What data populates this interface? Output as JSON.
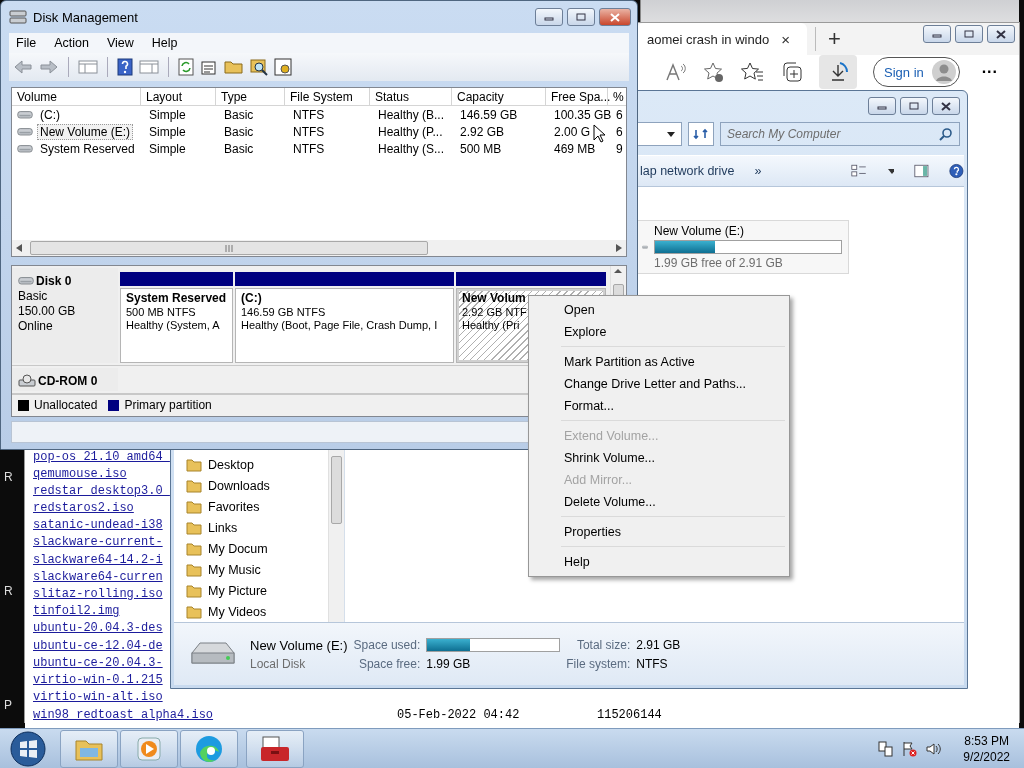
{
  "desktop": {
    "letters": [
      "R",
      "R",
      "P"
    ]
  },
  "browser": {
    "tab": {
      "title": "aomei crash in windo",
      "close": "×"
    },
    "new_tab": "+",
    "sign_in": "Sign in",
    "more": "···",
    "files": [
      {
        "name": "pop-os_21.10_amd64_"
      },
      {
        "name": "qemumouse.iso"
      },
      {
        "name": "redstar_desktop3.0_"
      },
      {
        "name": "redstaros2.iso"
      },
      {
        "name": "satanic-undead-i38"
      },
      {
        "name": "slackware-current-"
      },
      {
        "name": "slackware64-14.2-i"
      },
      {
        "name": "slackware64-curren"
      },
      {
        "name": "slitaz-rolling.iso"
      },
      {
        "name": "tinfoil2.img"
      },
      {
        "name": "ubuntu-20.04.3-des"
      },
      {
        "name": "ubuntu-ce-12.04-de"
      },
      {
        "name": "ubuntu-ce-20.04.3-"
      },
      {
        "name": "virtio-win-0.1.215"
      },
      {
        "name": "virtio-win-alt.iso"
      },
      {
        "name": "win98_redtoast_alpha4.iso",
        "date": "05-Feb-2022 04:42",
        "size": "115206144"
      }
    ]
  },
  "explorer": {
    "search": {
      "placeholder": "Search My Computer"
    },
    "command": "lap network drive",
    "more_commands": "»",
    "nav_items": [
      "Desktop",
      "Downloads",
      "Favorites",
      "Links",
      "My Docum",
      "My Music",
      "My Picture",
      "My Videos"
    ],
    "drive_tile": {
      "name": "New Volume (E:)",
      "level": 0.32,
      "free_text": "1.99 GB free of 2.91 GB"
    },
    "details": {
      "name": "New Volume (E:)",
      "type": "Local Disk",
      "space_used_label": "Space used:",
      "level": 0.32,
      "space_free_label": "Space free:",
      "space_free": "1.99 GB",
      "total_size_label": "Total size:",
      "total_size": "2.91 GB",
      "file_system_label": "File system:",
      "file_system": "NTFS"
    }
  },
  "disk_management": {
    "title": "Disk Management",
    "menu": [
      "File",
      "Action",
      "View",
      "Help"
    ],
    "columns": [
      "Volume",
      "Layout",
      "Type",
      "File System",
      "Status",
      "Capacity",
      "Free Spa...",
      "%"
    ],
    "volumes": [
      {
        "selected": false,
        "cells": [
          "(C:)",
          "Simple",
          "Basic",
          "NTFS",
          "Healthy (B...",
          "146.59 GB",
          "100.35 GB",
          "6"
        ]
      },
      {
        "selected": true,
        "cells": [
          "New Volume (E:)",
          "Simple",
          "Basic",
          "NTFS",
          "Healthy (P...",
          "2.92 GB",
          "2.00 G",
          "6"
        ]
      },
      {
        "selected": false,
        "cells": [
          "System Reserved",
          "Simple",
          "Basic",
          "NTFS",
          "Healthy (S...",
          "500 MB",
          "469 MB",
          "9"
        ]
      }
    ],
    "disks": [
      {
        "kind": "disk",
        "name": "Disk 0",
        "lines": [
          "Basic",
          "150.00 GB",
          "Online"
        ],
        "partitions": [
          {
            "name": "System Reserved",
            "size": "500 MB NTFS",
            "status": "Healthy (System, A",
            "selected": false
          },
          {
            "name": "(C:)",
            "size": "146.59 GB NTFS",
            "status": "Healthy (Boot, Page File, Crash Dump, I",
            "selected": false
          },
          {
            "name": "New Volum",
            "size": "2.92 GB NTF",
            "status": "Healthy (Pri",
            "selected": true
          }
        ]
      },
      {
        "kind": "cdrom",
        "name": "CD-ROM 0"
      }
    ],
    "legend": [
      {
        "label": "Unallocated",
        "color": "#000000"
      },
      {
        "label": "Primary partition",
        "color": "#000080"
      }
    ]
  },
  "context_menu": {
    "items": [
      {
        "kind": "item",
        "label": "Open",
        "disabled": false
      },
      {
        "kind": "item",
        "label": "Explore",
        "disabled": false
      },
      {
        "kind": "separator"
      },
      {
        "kind": "item",
        "label": "Mark Partition as Active",
        "disabled": false
      },
      {
        "kind": "item",
        "label": "Change Drive Letter and Paths...",
        "disabled": false
      },
      {
        "kind": "item",
        "label": "Format...",
        "disabled": false
      },
      {
        "kind": "separator"
      },
      {
        "kind": "item",
        "label": "Extend Volume...",
        "disabled": true
      },
      {
        "kind": "item",
        "label": "Shrink Volume...",
        "disabled": false
      },
      {
        "kind": "item",
        "label": "Add Mirror...",
        "disabled": true
      },
      {
        "kind": "item",
        "label": "Delete Volume...",
        "disabled": false
      },
      {
        "kind": "separator"
      },
      {
        "kind": "item",
        "label": "Properties",
        "disabled": false
      },
      {
        "kind": "separator"
      },
      {
        "kind": "item",
        "label": "Help",
        "disabled": false
      }
    ]
  },
  "taskbar": {
    "apps": [
      {
        "kind": "explorer"
      },
      {
        "kind": "media"
      },
      {
        "kind": "edge"
      },
      {
        "kind": "toolbox"
      }
    ],
    "time": "8:53 PM",
    "date": "9/2/2022"
  }
}
